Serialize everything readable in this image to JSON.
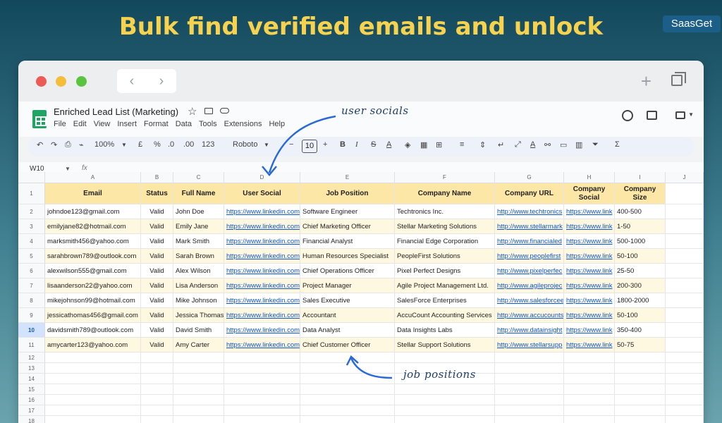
{
  "headline": "Bulk find verified emails and unlock",
  "brand": "SaasGet",
  "browser": {
    "back": "‹",
    "forward": "›",
    "new_tab": "+"
  },
  "doc": {
    "title": "Enriched Lead List (Marketing)",
    "menu": [
      "File",
      "Edit",
      "View",
      "Insert",
      "Format",
      "Data",
      "Tools",
      "Extensions",
      "Help"
    ]
  },
  "toolbar": {
    "zoom": "100%",
    "currency": "£",
    "percent": "%",
    "decimal_decrease": ".0",
    "decimal_increase": ".00",
    "number_format": "123",
    "font": "Roboto",
    "font_size": "10",
    "bold": "B",
    "italic": "I",
    "strike": "S",
    "text_color": "A",
    "sum": "Σ"
  },
  "formula_bar": {
    "cell_ref": "W10",
    "fx": "fx"
  },
  "columns": [
    "A",
    "B",
    "C",
    "D",
    "E",
    "F",
    "G",
    "H",
    "I",
    "J"
  ],
  "headers": [
    "Email",
    "Status",
    "Full Name",
    "User Social",
    "Job Position",
    "Company Name",
    "Company URL",
    "Company Social",
    "Company Size"
  ],
  "rows": [
    [
      "johndoe123@gmail.com",
      "Valid",
      "John Doe",
      "https://www.linkedin.com",
      "Software Engineer",
      "Techtronics Inc.",
      "http://www.techtronics",
      "https://www.link",
      "400-500"
    ],
    [
      "emilyjane82@hotmail.com",
      "Valid",
      "Emily Jane",
      "https://www.linkedin.com",
      "Chief Marketing Officer",
      "Stellar Marketing Solutions",
      "http://www.stellarmark",
      "https://www.link",
      "1-50"
    ],
    [
      "marksmith456@yahoo.com",
      "Valid",
      "Mark Smith",
      "https://www.linkedin.com",
      "Financial Analyst",
      "Financial Edge Corporation",
      "http://www.financialed",
      "https://www.link",
      "500-1000"
    ],
    [
      "sarahbrown789@outlook.com",
      "Valid",
      "Sarah Brown",
      "https://www.linkedin.com",
      "Human Resources Specialist",
      "PeopleFirst Solutions",
      "http://www.peoplefirst",
      "https://www.link",
      "50-100"
    ],
    [
      "alexwilson555@gmail.com",
      "Valid",
      "Alex Wilson",
      "https://www.linkedin.com",
      "Chief Operations Officer",
      "Pixel Perfect Designs",
      "http://www.pixelperfec",
      "https://www.link",
      "25-50"
    ],
    [
      "lisaanderson22@yahoo.com",
      "Valid",
      "Lisa Anderson",
      "https://www.linkedin.com",
      "Project Manager",
      "Agile Project Management Ltd.",
      "http://www.agileprojec",
      "https://www.link",
      "200-300"
    ],
    [
      "mikejohnson99@hotmail.com",
      "Valid",
      "Mike Johnson",
      "https://www.linkedin.com",
      "Sales Executive",
      "SalesForce Enterprises",
      "http://www.salesforcee",
      "https://www.link",
      "1800-2000"
    ],
    [
      "jessicathomas456@gmail.com",
      "Valid",
      "Jessica Thomas",
      "https://www.linkedin.com",
      "Accountant",
      "AccuCount Accounting Services",
      "http://www.accucounts",
      "https://www.link",
      "50-100"
    ],
    [
      "davidsmith789@outlook.com",
      "Valid",
      "David Smith",
      "https://www.linkedin.com",
      "Data Analyst",
      "Data Insights Labs",
      "http://www.datainsight",
      "https://www.link",
      "350-400"
    ],
    [
      "amycarter123@yahoo.com",
      "Valid",
      "Amy Carter",
      "https://www.linkedin.com",
      "Chief Customer Officer",
      "Stellar Support Solutions",
      "http://www.stellarsupp",
      "https://www.link",
      "50-75"
    ]
  ],
  "row_numbers": [
    "1",
    "2",
    "3",
    "4",
    "5",
    "6",
    "7",
    "8",
    "9",
    "10",
    "11",
    "12",
    "13",
    "14",
    "15",
    "16",
    "17",
    "18"
  ],
  "selected_row": "10",
  "annotations": {
    "user_socials": "user socials",
    "job_positions": "job positions"
  },
  "colors": {
    "header_fill": "#fde7a6",
    "row_fill": "#fff8e1",
    "accent_yellow": "#f6d24e",
    "link": "#1155cc"
  }
}
